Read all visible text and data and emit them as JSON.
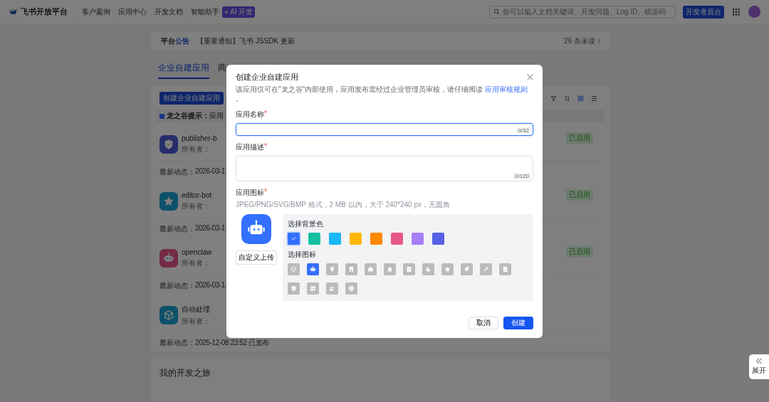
{
  "header": {
    "brand": "飞书开放平台",
    "nav": [
      {
        "label": "客户案例"
      },
      {
        "label": "应用中心"
      },
      {
        "label": "开发文档"
      },
      {
        "label": "智能助手",
        "badge": "AI 开发"
      }
    ],
    "search": {
      "placeholder": "你可以输入文档关键词、开发问题、Log ID、错误码"
    },
    "console_button": "开发者后台"
  },
  "announcement": {
    "title_lead": "平台",
    "title_accent": "公告",
    "text": "【重要通知】飞书 JSSDK 更新",
    "unread": "26 条未读"
  },
  "tabs": [
    {
      "label": "企业自建应用",
      "selected": true
    },
    {
      "label": "商",
      "selected": false
    }
  ],
  "create_button": "创建企业自建应用",
  "view_modes": [
    {
      "kind": "grid",
      "selected": true
    },
    {
      "kind": "list",
      "selected": false
    }
  ],
  "tip": "**龙之谷提示：**应用",
  "apps": [
    {
      "name": "publisher-b",
      "kind": "shield",
      "owner_label": "所有者：",
      "updated_label": "最新动态：",
      "updated": "2026-03-1",
      "status": "已启用"
    },
    {
      "name": "editor-bot",
      "kind": "star",
      "owner_label": "所有者：",
      "updated_label": "最新动态：",
      "updated": "2026-03-1",
      "status": "已启用"
    },
    {
      "name": "openclaw",
      "kind": "robot",
      "owner_label": "所有者：",
      "updated_label": "最新动态：",
      "updated": "2026-03-1",
      "status": "已启用"
    },
    {
      "name": "自动处理",
      "kind": "cube",
      "owner_label": "所有者：",
      "updated_label": "最新动态：",
      "updated": "2025-12-08 23:52 已发布"
    }
  ],
  "journey_title": "我的开发之旅",
  "side_toggle": "展开",
  "dialog": {
    "title": "创建企业自建应用",
    "description": "该应用仅可在\"龙之谷\"内部使用，应用发布需经过企业管理员审核，请仔细阅读",
    "link": "应用审核规则",
    "description_end": "。",
    "name_field": {
      "label": "应用名称",
      "required_mark": "*",
      "counter": "0/32",
      "focused": true
    },
    "desc_field": {
      "label": "应用描述",
      "required_mark": "*",
      "counter": "0/120",
      "focused": false
    },
    "icon_field": {
      "label": "应用图标",
      "required_mark": "*",
      "hint": "JPEG/PNG/SVG/BMP 格式，2 MB 以内，大于 240*240 px，无圆角"
    },
    "upload_button": "自定义上传",
    "bg_label": "选择背景色",
    "colors": [
      {
        "color": "#3370ff",
        "selected": true
      },
      {
        "color": "#14c0a0",
        "selected": false
      },
      {
        "color": "#1ab6f5",
        "selected": false
      },
      {
        "color": "#ffb800",
        "selected": false
      },
      {
        "color": "#ff8800",
        "selected": false
      },
      {
        "color": "#e8578a",
        "selected": false
      },
      {
        "color": "#a67ef5",
        "selected": false
      },
      {
        "color": "#5661e6",
        "selected": false
      }
    ],
    "icon_label": "选择图标",
    "icons": [
      {
        "kind": "cube",
        "selected": false
      },
      {
        "kind": "robot",
        "selected": true
      },
      {
        "kind": "pin",
        "selected": false
      },
      {
        "kind": "building",
        "selected": false
      },
      {
        "kind": "briefcase",
        "selected": false
      },
      {
        "kind": "bell",
        "selected": false
      },
      {
        "kind": "chart",
        "selected": false
      },
      {
        "kind": "pie",
        "selected": false
      },
      {
        "kind": "star",
        "selected": false
      },
      {
        "kind": "tag",
        "selected": false
      },
      {
        "kind": "wrench",
        "selected": false
      },
      {
        "kind": "document",
        "selected": false
      },
      {
        "kind": "shield",
        "selected": false
      },
      {
        "kind": "layout",
        "selected": false
      },
      {
        "kind": "people",
        "selected": false
      },
      {
        "kind": "power",
        "selected": false
      }
    ],
    "cancel_button": "取消",
    "create_button": "创建"
  }
}
